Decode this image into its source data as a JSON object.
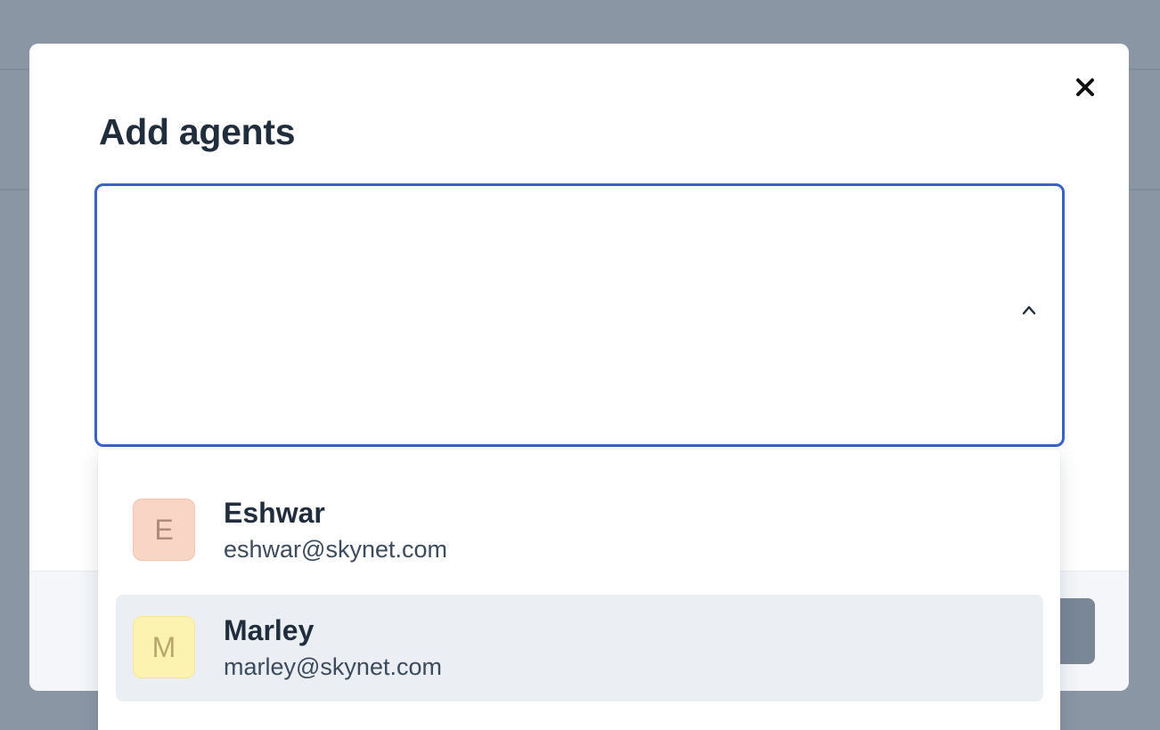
{
  "modal": {
    "title": "Add agents",
    "close_icon": "close-icon",
    "select": {
      "chevron_icon": "chevron-up-icon",
      "state": "open",
      "border_color": "#3a62c4"
    },
    "options": [
      {
        "initial": "E",
        "name": "Eshwar",
        "email": "eshwar@skynet.com",
        "avatar_bg": "#f9d5c5",
        "avatar_border": "#f4c4b0",
        "avatar_text": "#b08a7c",
        "highlighted": false
      },
      {
        "initial": "M",
        "name": "Marley",
        "email": "marley@skynet.com",
        "avatar_bg": "#fdf3b1",
        "avatar_border": "#f7e697",
        "avatar_text": "#b8a76a",
        "highlighted": true
      }
    ]
  },
  "colors": {
    "overlay": "#8a96a3",
    "title_text": "#1f2d3d",
    "highlight_bg": "#ebeef3"
  }
}
